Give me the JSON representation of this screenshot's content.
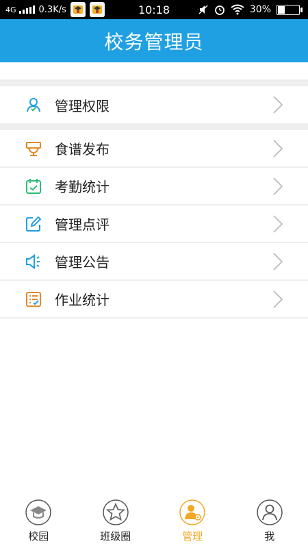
{
  "status_bar": {
    "network": "4G",
    "speed": "0.3K/s",
    "time": "10:18",
    "battery": "30%",
    "battery_level": 0.3
  },
  "header": {
    "title": "校务管理员"
  },
  "menu": {
    "items": [
      {
        "label": "管理权限",
        "icon": "user-icon",
        "color": "#1fa0e3"
      },
      {
        "label": "食谱发布",
        "icon": "bowl-icon",
        "color": "#e08a2b"
      },
      {
        "label": "考勤统计",
        "icon": "calendar-check-icon",
        "color": "#2dbd7a"
      },
      {
        "label": "管理点评",
        "icon": "edit-icon",
        "color": "#1fa0e3"
      },
      {
        "label": "管理公告",
        "icon": "speaker-icon",
        "color": "#1fa0e3"
      },
      {
        "label": "作业统计",
        "icon": "list-check-icon",
        "color": "#e08a2b"
      }
    ]
  },
  "bottom_nav": {
    "items": [
      {
        "label": "校园",
        "icon": "graduation-cap-icon"
      },
      {
        "label": "班级圈",
        "icon": "star-icon"
      },
      {
        "label": "管理",
        "icon": "manage-user-icon",
        "active": true
      },
      {
        "label": "我",
        "icon": "profile-icon"
      }
    ]
  },
  "colors": {
    "header_bg": "#1fa0e3",
    "active_tab": "#f5a623"
  }
}
